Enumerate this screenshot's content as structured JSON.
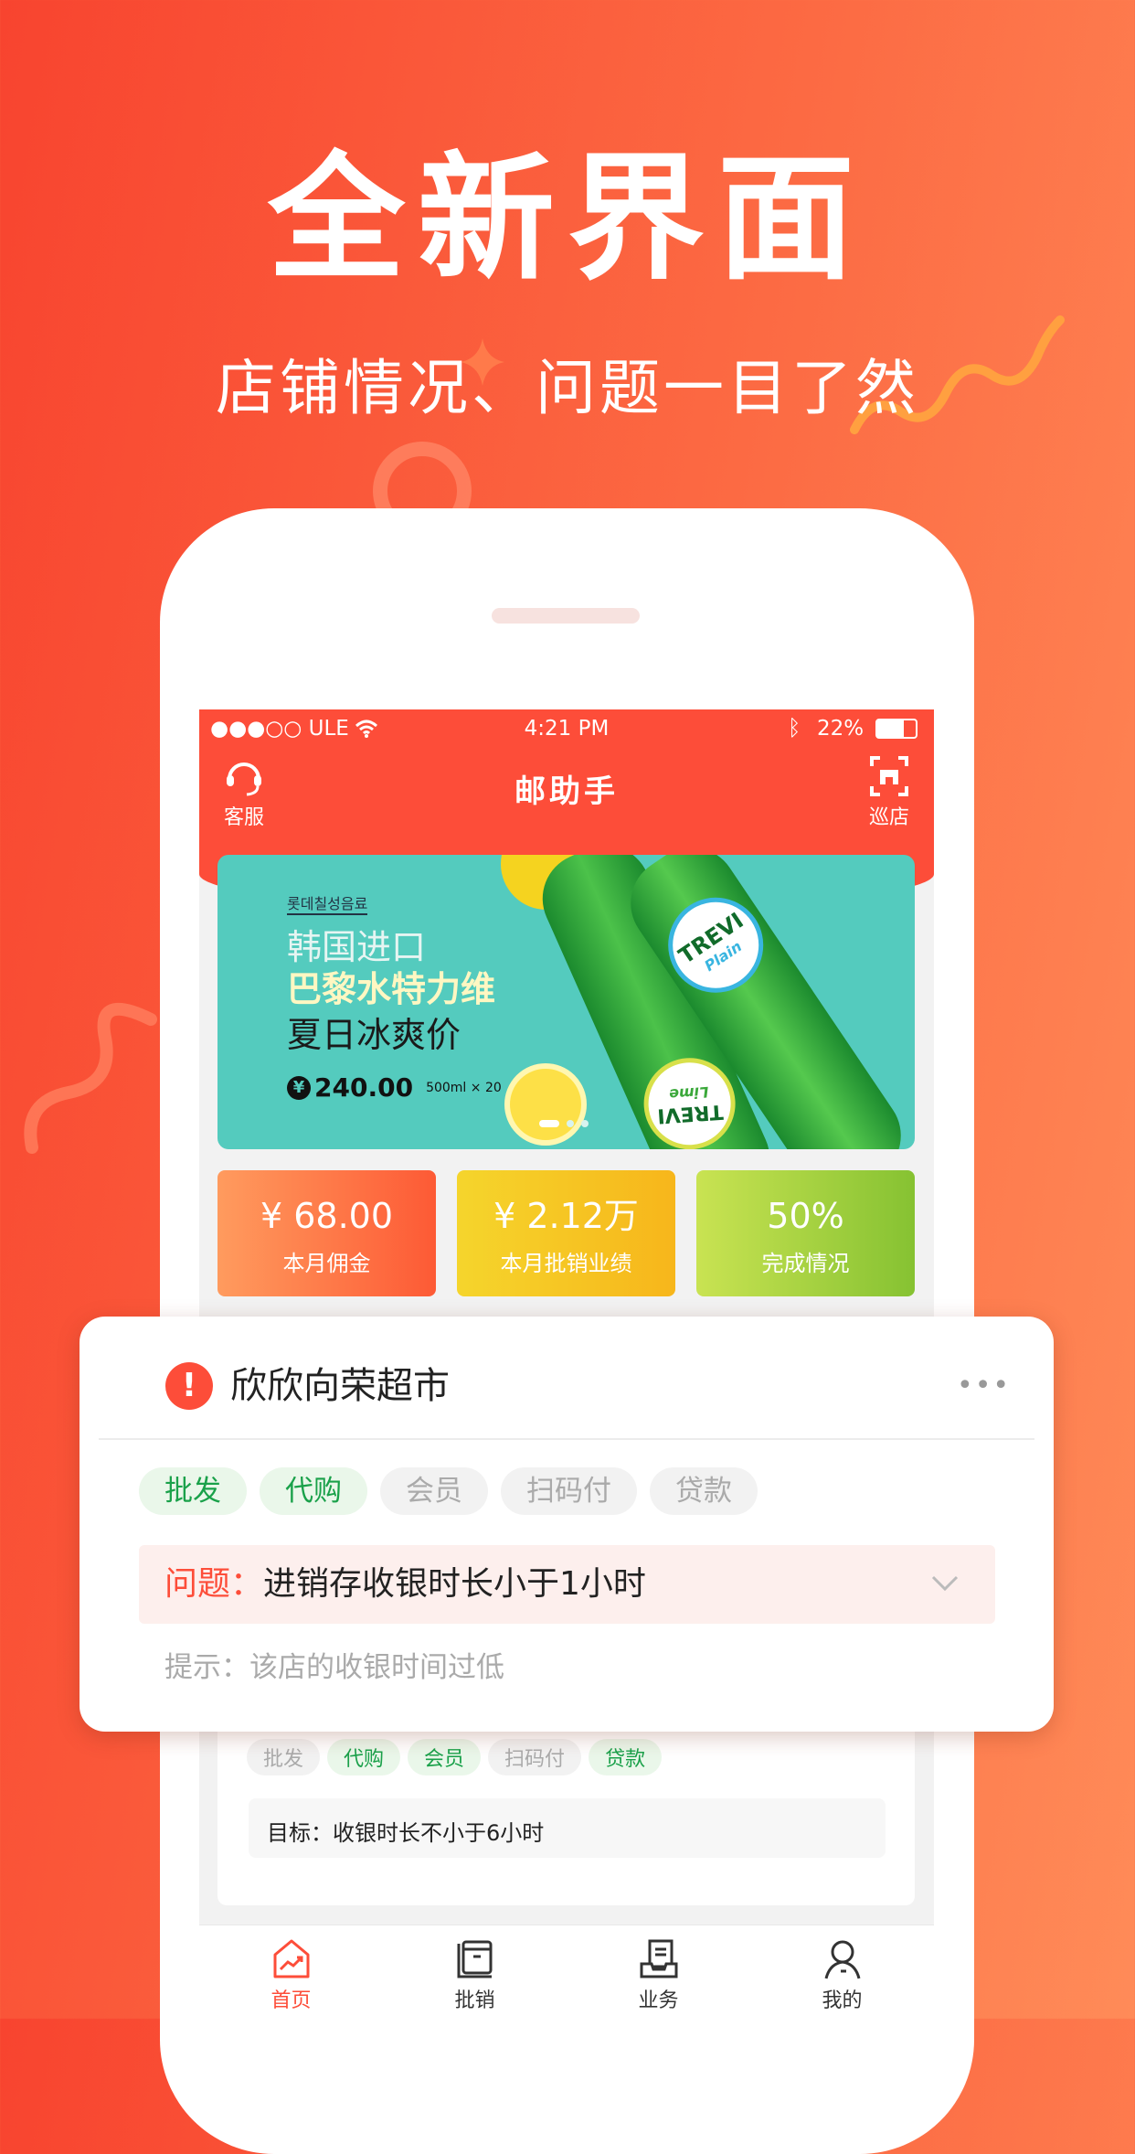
{
  "hero": {
    "title": "全新界面",
    "subtitle": "店铺情况、问题一目了然"
  },
  "status_bar": {
    "carrier": "●●●○○ ULE",
    "time": "4:21 PM",
    "battery": "22%",
    "battery_level": 0.22
  },
  "nav": {
    "title": "邮助手",
    "left_label": "客服",
    "right_label": "巡店",
    "left_icon": "headset-icon",
    "right_icon": "scan-store-icon"
  },
  "banner": {
    "brand": "롯데칠성음료",
    "line1": "韩国进口",
    "line2": "巴黎水特力维",
    "line3": "夏日冰爽价",
    "price": "240.00",
    "currency": "¥",
    "spec": "500ml × 20",
    "bottle_label": "TREVI",
    "bottle_sub1": "Plain",
    "bottle_sub2": "Lime",
    "pages": 3,
    "active_page": 0
  },
  "stats": [
    {
      "value": "¥ 68.00",
      "label": "本月佣金",
      "colors": [
        "#ff9b5e",
        "#fd5a35"
      ]
    },
    {
      "value": "¥ 2.12万",
      "label": "本月批销业绩",
      "colors": [
        "#f5d52c",
        "#f7b61b"
      ]
    },
    {
      "value": "50%",
      "label": "完成情况",
      "colors": [
        "#c9e352",
        "#86c232"
      ]
    }
  ],
  "underlying_card": {
    "tags": [
      {
        "label": "批发",
        "active": false
      },
      {
        "label": "代购",
        "active": true
      },
      {
        "label": "会员",
        "active": true
      },
      {
        "label": "扫码付",
        "active": false
      },
      {
        "label": "贷款",
        "active": true
      }
    ],
    "goal": "目标：收银时长不小于6小时"
  },
  "popup": {
    "store_name": "欣欣向荣超市",
    "tags": [
      {
        "label": "批发",
        "active": true
      },
      {
        "label": "代购",
        "active": true
      },
      {
        "label": "会员",
        "active": false
      },
      {
        "label": "扫码付",
        "active": false
      },
      {
        "label": "贷款",
        "active": false
      }
    ],
    "problem_label": "问题：",
    "problem_text": "进销存收银时长小于1小时",
    "hint": "提示：该店的收银时间过低"
  },
  "tabbar": [
    {
      "label": "首页",
      "icon": "home-chart-icon",
      "active": true
    },
    {
      "label": "批销",
      "icon": "box-icon",
      "active": false
    },
    {
      "label": "业务",
      "icon": "documents-tray-icon",
      "active": false
    },
    {
      "label": "我的",
      "icon": "user-icon",
      "active": false
    }
  ],
  "colors": {
    "accent": "#fd4d39",
    "green": "#1aa14a",
    "teal": "#54cbbe"
  }
}
